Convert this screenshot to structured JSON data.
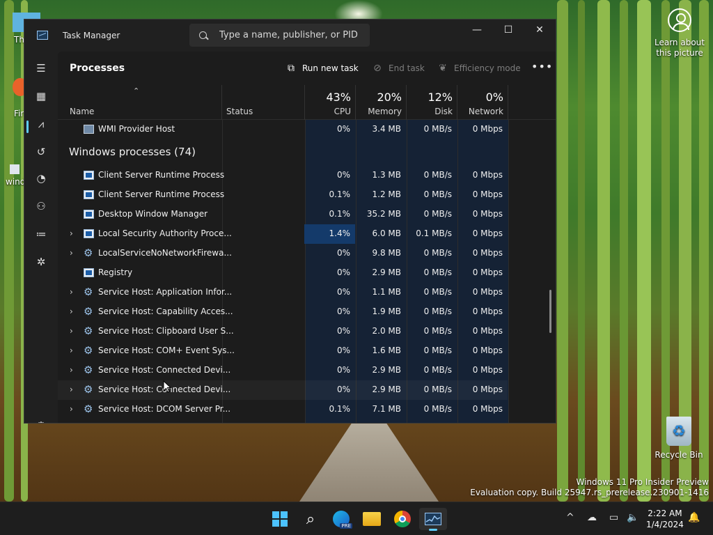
{
  "desktop": {
    "learn_label": "Learn about this picture",
    "recycle_label": "Recycle Bin",
    "left_labels": [
      "Th",
      "Fir",
      "wind"
    ],
    "watermark_line1": "Windows 11 Pro Insider Preview",
    "watermark_line2": "Evaluation copy. Build 25947.rs_prerelease.230901-1416"
  },
  "window": {
    "title": "Task Manager",
    "search_placeholder": "Type a name, publisher, or PID...",
    "controls": {
      "minimize": "—",
      "maximize": "☐",
      "close": "✕"
    }
  },
  "nav": {
    "items": [
      {
        "name": "hamburger-icon",
        "glyph": "☰"
      },
      {
        "name": "processes-icon",
        "glyph": "▦"
      },
      {
        "name": "performance-icon",
        "glyph": "⩘"
      },
      {
        "name": "app-history-icon",
        "glyph": "↺"
      },
      {
        "name": "startup-apps-icon",
        "glyph": "◔"
      },
      {
        "name": "users-icon",
        "glyph": "⚇"
      },
      {
        "name": "details-icon",
        "glyph": "≔"
      },
      {
        "name": "services-icon",
        "glyph": "✲"
      }
    ],
    "settings_glyph": "⚙"
  },
  "toolbar": {
    "page_title": "Processes",
    "run_new_task": "Run new task",
    "end_task": "End task",
    "efficiency_mode": "Efficiency mode",
    "more": "•••"
  },
  "columns": {
    "name": "Name",
    "status": "Status",
    "cpu": {
      "label": "CPU",
      "pct": "43%"
    },
    "memory": {
      "label": "Memory",
      "pct": "20%"
    },
    "disk": {
      "label": "Disk",
      "pct": "12%"
    },
    "network": {
      "label": "Network",
      "pct": "0%"
    }
  },
  "top_row": {
    "name": "WMI Provider Host",
    "cpu": "0%",
    "mem": "3.4 MB",
    "disk": "0 MB/s",
    "net": "0 Mbps"
  },
  "group_label": "Windows processes (74)",
  "processes": [
    {
      "name": "Client Server Runtime Process",
      "icon": "win",
      "expand": false,
      "cpu": "0%",
      "mem": "1.3 MB",
      "disk": "0 MB/s",
      "net": "0 Mbps"
    },
    {
      "name": "Client Server Runtime Process",
      "icon": "win",
      "expand": false,
      "cpu": "0.1%",
      "mem": "1.2 MB",
      "disk": "0 MB/s",
      "net": "0 Mbps"
    },
    {
      "name": "Desktop Window Manager",
      "icon": "win",
      "expand": false,
      "cpu": "0.1%",
      "mem": "35.2 MB",
      "disk": "0 MB/s",
      "net": "0 Mbps"
    },
    {
      "name": "Local Security Authority Proce...",
      "icon": "win",
      "expand": true,
      "cpu": "1.4%",
      "mem": "6.0 MB",
      "disk": "0.1 MB/s",
      "net": "0 Mbps",
      "cpu_high": true
    },
    {
      "name": "LocalServiceNoNetworkFirewa...",
      "icon": "gear",
      "expand": true,
      "cpu": "0%",
      "mem": "9.8 MB",
      "disk": "0 MB/s",
      "net": "0 Mbps"
    },
    {
      "name": "Registry",
      "icon": "win",
      "expand": false,
      "cpu": "0%",
      "mem": "2.9 MB",
      "disk": "0 MB/s",
      "net": "0 Mbps"
    },
    {
      "name": "Service Host: Application Infor...",
      "icon": "gear",
      "expand": true,
      "cpu": "0%",
      "mem": "1.1 MB",
      "disk": "0 MB/s",
      "net": "0 Mbps"
    },
    {
      "name": "Service Host: Capability Acces...",
      "icon": "gear",
      "expand": true,
      "cpu": "0%",
      "mem": "1.9 MB",
      "disk": "0 MB/s",
      "net": "0 Mbps"
    },
    {
      "name": "Service Host: Clipboard User S...",
      "icon": "gear",
      "expand": true,
      "cpu": "0%",
      "mem": "2.0 MB",
      "disk": "0 MB/s",
      "net": "0 Mbps"
    },
    {
      "name": "Service Host: COM+ Event Sys...",
      "icon": "gear",
      "expand": true,
      "cpu": "0%",
      "mem": "1.6 MB",
      "disk": "0 MB/s",
      "net": "0 Mbps"
    },
    {
      "name": "Service Host: Connected Devi...",
      "icon": "gear",
      "expand": true,
      "cpu": "0%",
      "mem": "2.9 MB",
      "disk": "0 MB/s",
      "net": "0 Mbps"
    },
    {
      "name": "Service Host: Connected Devi...",
      "icon": "gear",
      "expand": true,
      "cpu": "0%",
      "mem": "2.9 MB",
      "disk": "0 MB/s",
      "net": "0 Mbps",
      "hover": true
    },
    {
      "name": "Service Host: DCOM Server Pr...",
      "icon": "gear",
      "expand": true,
      "cpu": "0.1%",
      "mem": "7.1 MB",
      "disk": "0 MB/s",
      "net": "0 Mbps"
    }
  ],
  "taskbar": {
    "apps": [
      {
        "name": "start-button",
        "glyph": "start"
      },
      {
        "name": "search-taskbar-button",
        "glyph": "⌕"
      },
      {
        "name": "edge-beta-button",
        "glyph": "◉"
      },
      {
        "name": "file-explorer-button",
        "glyph": "▬"
      },
      {
        "name": "chrome-button",
        "glyph": "◎"
      },
      {
        "name": "task-manager-taskbar-button",
        "glyph": "⩘"
      }
    ],
    "tray": {
      "chevron": "^",
      "cloud": "☁",
      "network": "▭",
      "volume": "🔈",
      "bell": "🔔"
    },
    "time": "2:22 AM",
    "date": "1/4/2024"
  },
  "colors": {
    "accent": "#60cdff",
    "cpu_high": "#143a6a",
    "col_bg": "#152235"
  }
}
